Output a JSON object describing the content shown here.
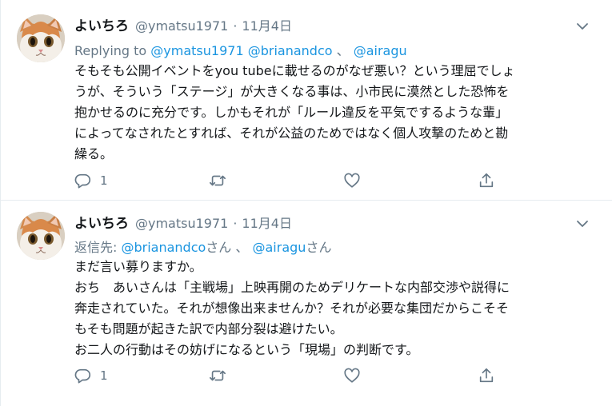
{
  "tweets": [
    {
      "display_name": "よいちろ",
      "handle": "@ymatsu1971",
      "separator": "·",
      "date": "11月4日",
      "reply_prefix": "Replying to ",
      "mentions": [
        "@ymatsu1971",
        "@brianandco",
        "@airagu"
      ],
      "mention_sep_1": " ",
      "mention_sep_2": " 、 ",
      "mention_suffix_1": "",
      "mention_suffix_2": "",
      "text_lines": [
        "そもそも公開イベントをyou tubeに載せるのがなぜ悪い？という理屈でしょ",
        "うが、そういう「ステージ」が大きくなる事は、小市民に漠然とした恐怖を",
        "抱かせるのに充分です。しかもそれが「ルール違反を平気でするような輩」",
        "によってなされたとすれば、それが公益のためではなく個人攻撃のためと勘",
        "繰る。"
      ],
      "reply_count": "1",
      "icons": [
        "reply-icon",
        "retweet-icon",
        "like-icon",
        "share-icon"
      ]
    },
    {
      "display_name": "よいちろ",
      "handle": "@ymatsu1971",
      "separator": "·",
      "date": "11月4日",
      "reply_prefix": "返信先: ",
      "mentions": [
        "@brianandco",
        "@airagu"
      ],
      "mention_suffix": "さん",
      "mention_sep": " 、 ",
      "text_lines": [
        "まだ言い募りますか。",
        "おち　あいさんは「主戦場」上映再開のためデリケートな内部交渉や説得に",
        "奔走されていた。それが想像出来ませんか？それが必要な集団だからこそそ",
        "もそも問題が起きた訳で内部分裂は避けたい。",
        "お二人の行動はその妨げになるという「現場」の判断です。"
      ],
      "reply_count": "1",
      "icons": [
        "reply-icon",
        "retweet-icon",
        "like-icon",
        "share-icon"
      ]
    }
  ],
  "colors": {
    "text": "#14171a",
    "secondary": "#657786",
    "link": "#1b95e0",
    "border": "#e6ecf0"
  }
}
